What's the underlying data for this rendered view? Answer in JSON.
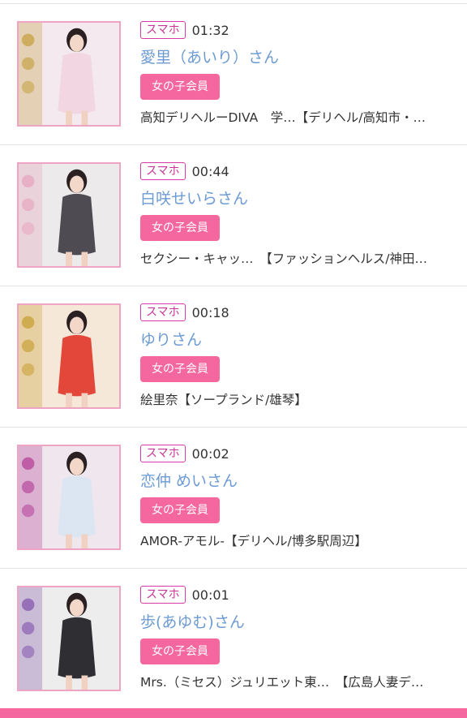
{
  "items": [
    {
      "badge": "スマホ",
      "time": "01:32",
      "name": "愛里（あいり）さん",
      "member_label": "女の子会員",
      "shop": "高知デリヘルーDIVA　学…【デリヘル/高知市・…",
      "thumb": {
        "bg": "#f3e9ee",
        "dress": "#f2d7e2",
        "accent": "#c8a44a"
      }
    },
    {
      "badge": "スマホ",
      "time": "00:44",
      "name": "白咲せいらさん",
      "member_label": "女の子会員",
      "shop": "セクシー・キャッ…　【ファッションヘルス/神田…",
      "thumb": {
        "bg": "#eceaea",
        "dress": "#4f4b52",
        "accent": "#e7a7c0"
      }
    },
    {
      "badge": "スマホ",
      "time": "00:18",
      "name": "ゆりさん",
      "member_label": "女の子会員",
      "shop": "絵里奈【ソープランド/雄琴】",
      "thumb": {
        "bg": "#f6e8d8",
        "dress": "#e2473a",
        "accent": "#c9a23b"
      }
    },
    {
      "badge": "スマホ",
      "time": "00:02",
      "name": "恋仲 めいさん",
      "member_label": "女の子会員",
      "shop": "AMOR-アモル-【デリヘル/博多駅周辺】",
      "thumb": {
        "bg": "#efe6ee",
        "dress": "#dbe6f2",
        "accent": "#b84a9c"
      }
    },
    {
      "badge": "スマホ",
      "time": "00:01",
      "name": "歩(あゆむ)さん",
      "member_label": "女の子会員",
      "shop": "Mrs.（ミセス）ジュリエット東…　【広島人妻デ…",
      "thumb": {
        "bg": "#ededed",
        "dress": "#2f2f33",
        "accent": "#8a5fb0"
      }
    }
  ],
  "colors": {
    "accent_pink": "#f5679f",
    "name_blue": "#6c9bd3",
    "badge_magenta": "#d63aa6"
  }
}
